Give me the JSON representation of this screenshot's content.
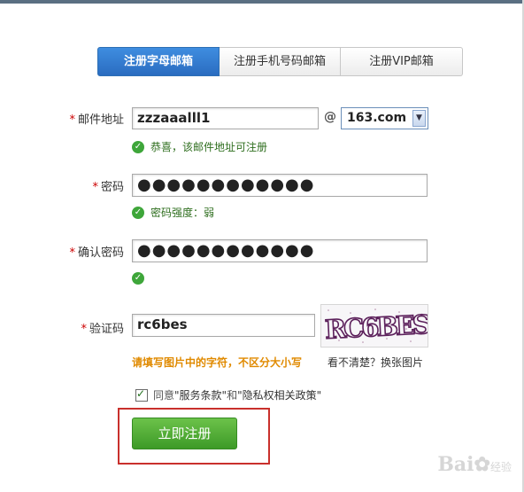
{
  "tabs": [
    {
      "label": "注册字母邮箱",
      "active": true
    },
    {
      "label": "注册手机号码邮箱",
      "active": false
    },
    {
      "label": "注册VIP邮箱",
      "active": false
    }
  ],
  "form": {
    "required_mark": "*",
    "email": {
      "label": "邮件地址",
      "value": "zzzaaalll1",
      "at": "@",
      "domain": "163.com",
      "status": "恭喜，该邮件地址可注册"
    },
    "password": {
      "label": "密码",
      "value": "●●●●●●●●●●●●",
      "status": "密码强度：弱"
    },
    "confirm": {
      "label": "确认密码",
      "value": "●●●●●●●●●●●●"
    },
    "captcha": {
      "label": "验证码",
      "value": "rc6bes",
      "image_text": "RC6BES",
      "hint": "请填写图片中的字符，不区分大小写",
      "refresh": "看不清楚？换张图片"
    },
    "agree": {
      "prefix": "同意",
      "terms": "\"服务条款\"",
      "and": "和",
      "privacy": "\"隐私权相关政策\""
    },
    "submit": "立即注册"
  },
  "watermark": {
    "text": "Bai",
    "suffix": "经验"
  },
  "colors": {
    "tab_active": "#2a6cc0",
    "button": "#3d9a27",
    "highlight_box": "#c9302c",
    "hint": "#e08a00"
  }
}
